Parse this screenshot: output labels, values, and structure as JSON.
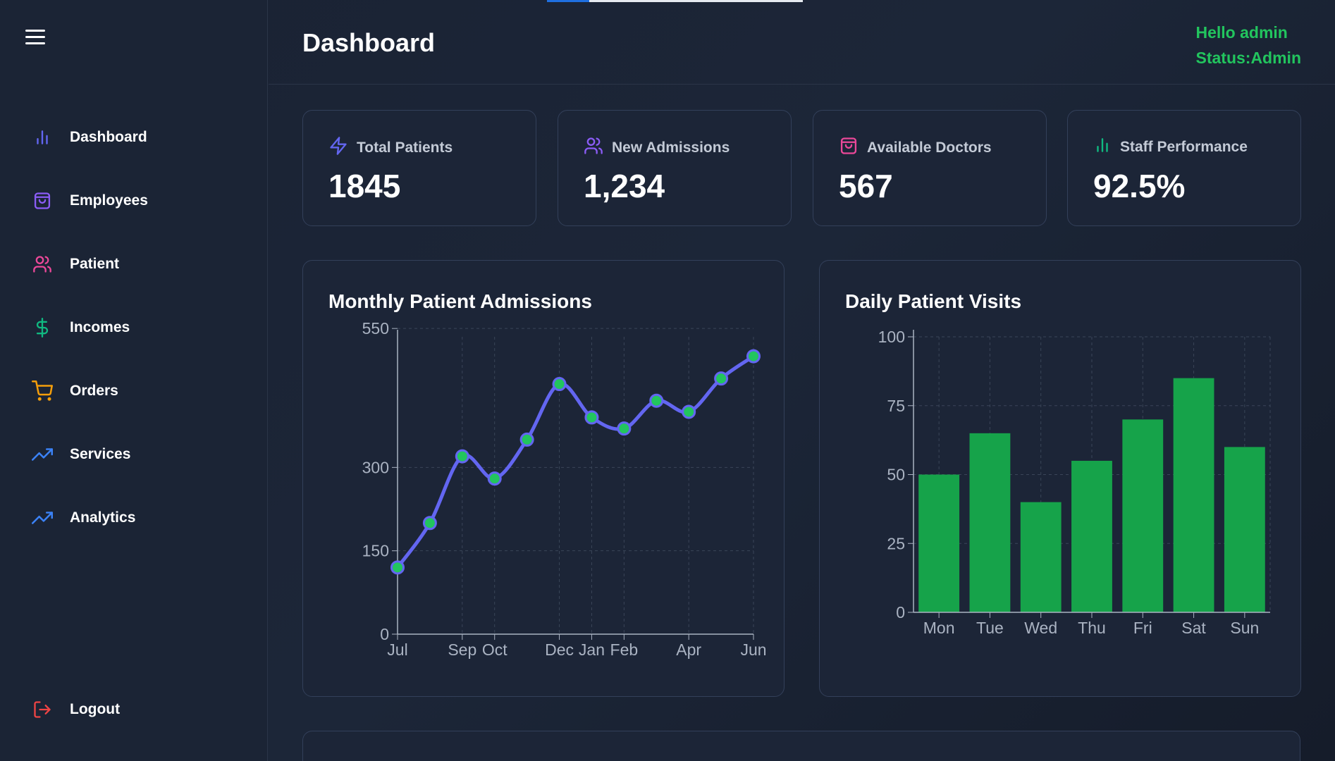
{
  "header": {
    "title": "Dashboard",
    "greeting": "Hello admin",
    "status": "Status:Admin",
    "progress": 0.165
  },
  "sidebar": {
    "menu_icon": "hamburger-menu-icon",
    "items": [
      {
        "label": "Dashboard",
        "icon": "bar-chart-icon",
        "color": "#6366f1"
      },
      {
        "label": "Employees",
        "icon": "shopping-bag-icon",
        "color": "#8b5cf6"
      },
      {
        "label": "Patient",
        "icon": "users-icon",
        "color": "#ec4899"
      },
      {
        "label": "Incomes",
        "icon": "dollar-icon",
        "color": "#10b981"
      },
      {
        "label": "Orders",
        "icon": "shopping-cart-icon",
        "color": "#f59e0b"
      },
      {
        "label": "Services",
        "icon": "trending-up-icon",
        "color": "#3b82f6"
      },
      {
        "label": "Analytics",
        "icon": "trending-up-icon",
        "color": "#3b82f6"
      }
    ],
    "logout": {
      "label": "Logout",
      "icon": "logout-icon",
      "color": "#ef4444"
    }
  },
  "stats": [
    {
      "label": "Total Patients",
      "value": "1845",
      "icon": "lightning-icon",
      "color": "#6366f1"
    },
    {
      "label": "New Admissions",
      "value": "1,234",
      "icon": "users-icon",
      "color": "#8b5cf6"
    },
    {
      "label": "Available Doctors",
      "value": "567",
      "icon": "shopping-bag-icon",
      "color": "#ec4899"
    },
    {
      "label": "Staff Performance",
      "value": "92.5%",
      "icon": "bar-chart-icon",
      "color": "#10b981"
    }
  ],
  "chart_data": [
    {
      "type": "line",
      "title": "Monthly Patient Admissions",
      "x_index": [
        0,
        1,
        2,
        3,
        4,
        5,
        6,
        7,
        8,
        9,
        10,
        11
      ],
      "x_tick_labels": [
        {
          "index": 0,
          "label": "Jul"
        },
        {
          "index": 2,
          "label": "Sep"
        },
        {
          "index": 3,
          "label": "Oct"
        },
        {
          "index": 5,
          "label": "Dec"
        },
        {
          "index": 6,
          "label": "Jan"
        },
        {
          "index": 7,
          "label": "Feb"
        },
        {
          "index": 9,
          "label": "Apr"
        },
        {
          "index": 11,
          "label": "Jun"
        }
      ],
      "series": [
        {
          "values": [
            120,
            200,
            320,
            280,
            350,
            450,
            390,
            370,
            420,
            400,
            460,
            500
          ],
          "color": "#6366f1",
          "point_color": "#22c55e"
        }
      ],
      "y_ticks": [
        0,
        150,
        300,
        550
      ],
      "ylim": [
        0,
        535
      ],
      "grid": true
    },
    {
      "type": "bar",
      "title": "Daily Patient Visits",
      "categories": [
        "Mon",
        "Tue",
        "Wed",
        "Thu",
        "Fri",
        "Sat",
        "Sun"
      ],
      "values": [
        50,
        65,
        40,
        55,
        70,
        85,
        60
      ],
      "color": "#16a34a",
      "y_ticks": [
        0,
        25,
        50,
        75,
        100
      ],
      "ylim": [
        0,
        100
      ],
      "grid": true
    }
  ]
}
